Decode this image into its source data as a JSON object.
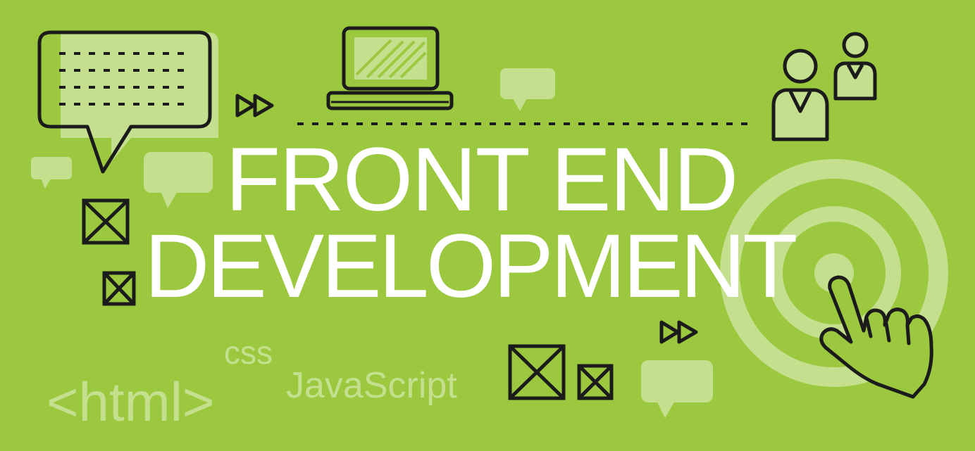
{
  "banner": {
    "title_line1": "FRONT END",
    "title_line2": "DEVELOPMENT",
    "code_labels": {
      "html": "<html>",
      "css": "css",
      "javascript": "JavaScript"
    }
  },
  "colors": {
    "background": "#9bc83f",
    "pale_accent": "#c4e08f",
    "outline": "#1b1b1b",
    "title_text": "#ffffff"
  },
  "icons": [
    "chat-bubble-icon",
    "fast-forward-icon",
    "laptop-icon",
    "users-icon",
    "target-icon",
    "pointing-hand-icon",
    "image-placeholder-icon"
  ]
}
